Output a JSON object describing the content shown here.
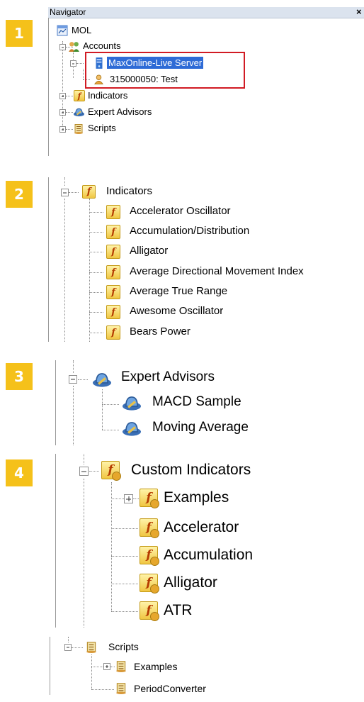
{
  "badges": [
    "1",
    "2",
    "3",
    "4"
  ],
  "panel1": {
    "title": "Navigator",
    "close": "×",
    "root": "MOL",
    "accounts": "Accounts",
    "server": "MaxOnline-Live Server",
    "account": "315000050: Test",
    "indicators": "Indicators",
    "expert_advisors": "Expert Advisors",
    "scripts": "Scripts"
  },
  "panel2": {
    "header": "Indicators",
    "items": [
      "Accelerator Oscillator",
      "Accumulation/Distribution",
      "Alligator",
      "Average Directional Movement Index",
      "Average True Range",
      "Awesome Oscillator",
      "Bears Power"
    ]
  },
  "panel3": {
    "header": "Expert Advisors",
    "items": [
      "MACD Sample",
      "Moving Average"
    ]
  },
  "panel4": {
    "header": "Custom Indicators",
    "items": [
      "Examples",
      "Accelerator",
      "Accumulation",
      "Alligator",
      "ATR"
    ]
  },
  "panel5": {
    "header": "Scripts",
    "items": [
      "Examples",
      "PeriodConverter"
    ]
  },
  "colors": {
    "badge": "#f5c11a",
    "selection": "#2e6bd6",
    "highlight_border": "#d11b24",
    "titlebar": "#dbe3ee"
  }
}
